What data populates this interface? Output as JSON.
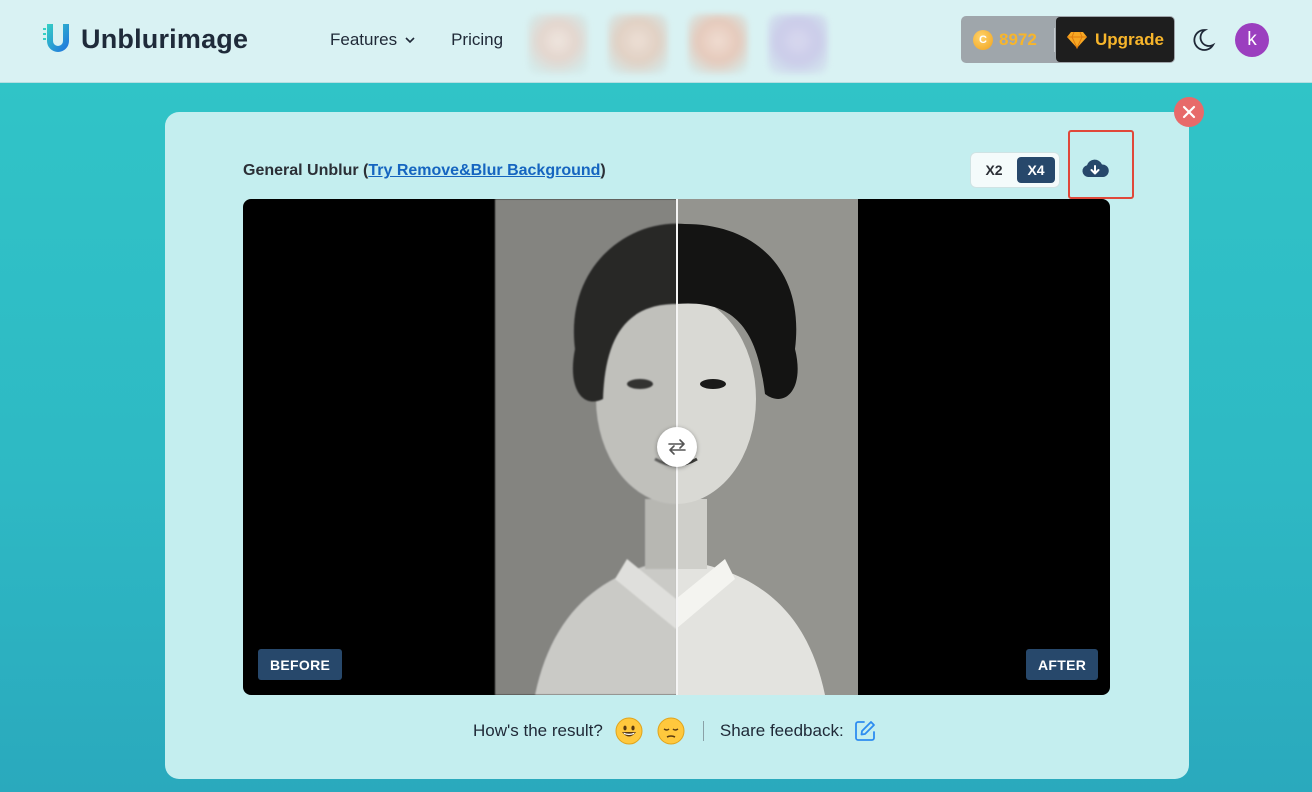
{
  "header": {
    "logo_text": "Unblurimage",
    "nav": [
      {
        "label": "Features",
        "has_dropdown": true
      },
      {
        "label": "Pricing",
        "has_dropdown": false
      }
    ],
    "credits": "8972",
    "upgrade_label": "Upgrade",
    "avatar_initial": "k",
    "accent_colors": {
      "coins": "#f7b52b",
      "avatar": "#9b3fbf",
      "dark_button": "#1e1e1e"
    }
  },
  "panel": {
    "mode_title_prefix": "General Unblur (",
    "mode_link": "Try Remove&Blur Background",
    "mode_title_suffix": ")",
    "scale_options": [
      "X2",
      "X4"
    ],
    "scale_selected": "X4",
    "download_icon": "cloud-download-icon",
    "close_icon": "close-icon"
  },
  "compare": {
    "before_label": "BEFORE",
    "after_label": "AFTER",
    "handle_icon": "swap-arrows-icon"
  },
  "feedback": {
    "question": "How's the result?",
    "share_label": "Share feedback:",
    "icons": [
      "grinning-face-icon",
      "pensive-face-icon",
      "edit-icon"
    ]
  }
}
